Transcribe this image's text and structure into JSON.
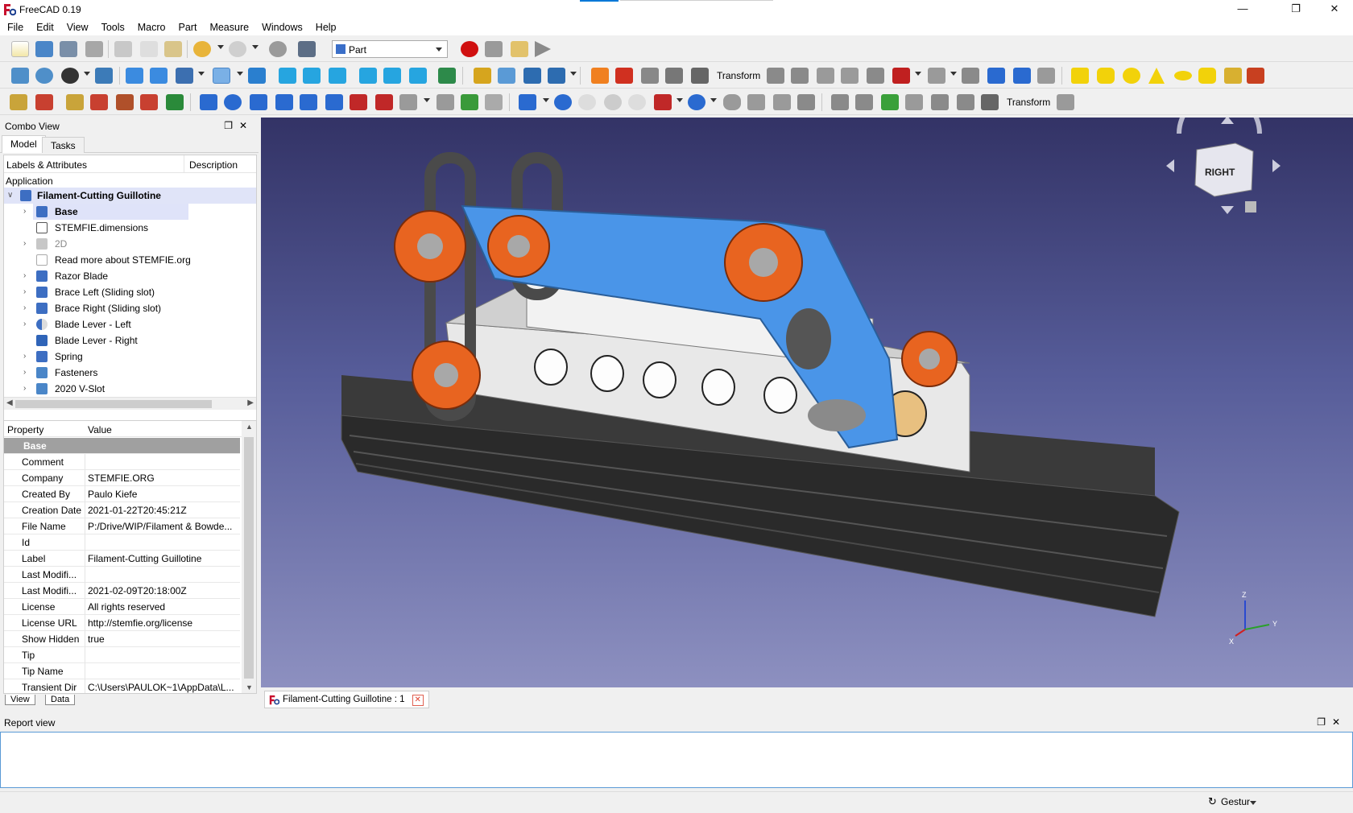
{
  "app": {
    "title": "FreeCAD 0.19",
    "window_controls": [
      "minimize",
      "restore",
      "close"
    ]
  },
  "menu": [
    "File",
    "Edit",
    "View",
    "Tools",
    "Macro",
    "Part",
    "Measure",
    "Windows",
    "Help"
  ],
  "toolbar": {
    "workbench": "Part",
    "transform_label_1": "Transform",
    "transform_label_2": "Transform"
  },
  "combo_view": {
    "title": "Combo View",
    "tabs": [
      "Model",
      "Tasks"
    ],
    "tree_headers": [
      "Labels & Attributes",
      "Description"
    ],
    "section": "Application",
    "document": "Filament-Cutting Guillotine",
    "items": [
      {
        "label": "Base",
        "icon": "part-icon"
      },
      {
        "label": "STEMFIE.dimensions",
        "icon": "spreadsheet-icon"
      },
      {
        "label": "2D",
        "icon": "folder-icon"
      },
      {
        "label": "Read more about STEMFIE.org",
        "icon": "text-document-icon"
      },
      {
        "label": "Razor Blade",
        "icon": "part-icon"
      },
      {
        "label": "Brace Left (Sliding slot)",
        "icon": "part-icon"
      },
      {
        "label": "Brace Right (Sliding slot)",
        "icon": "part-icon"
      },
      {
        "label": "Blade Lever - Left",
        "icon": "part-half-icon"
      },
      {
        "label": "Blade Lever - Right",
        "icon": "solid-icon"
      },
      {
        "label": "Spring",
        "icon": "part-icon"
      },
      {
        "label": "Fasteners",
        "icon": "folder-icon"
      },
      {
        "label": "2020 V-Slot",
        "icon": "folder-icon"
      }
    ]
  },
  "property_editor": {
    "headers": [
      "Property",
      "Value"
    ],
    "group": "Base",
    "rows": [
      {
        "name": "Comment",
        "value": ""
      },
      {
        "name": "Company",
        "value": "STEMFIE.ORG"
      },
      {
        "name": "Created By",
        "value": "Paulo Kiefe"
      },
      {
        "name": "Creation Date",
        "value": "2021-01-22T20:45:21Z"
      },
      {
        "name": "File Name",
        "value": "P:/Drive/WIP/Filament & Bowde..."
      },
      {
        "name": "Id",
        "value": ""
      },
      {
        "name": "Label",
        "value": "Filament-Cutting Guillotine"
      },
      {
        "name": "Last Modifi...",
        "value": ""
      },
      {
        "name": "Last Modifi...",
        "value": "2021-02-09T20:18:00Z"
      },
      {
        "name": "License",
        "value": "All rights reserved"
      },
      {
        "name": "License URL",
        "value": "http://stemfie.org/license"
      },
      {
        "name": "Show Hidden",
        "value": "true"
      },
      {
        "name": "Tip",
        "value": ""
      },
      {
        "name": "Tip Name",
        "value": ""
      },
      {
        "name": "Transient Dir",
        "value": "C:\\Users\\PAULOK~1\\AppData\\L..."
      }
    ],
    "view_tabs": [
      "View",
      "Data"
    ]
  },
  "viewport": {
    "navcube_face": "RIGHT",
    "axes": [
      "Z",
      "Y",
      "X"
    ]
  },
  "document_tab": "Filament-Cutting Guillotine : 1",
  "report_view": {
    "title": "Report view"
  },
  "status": {
    "navigation_style": "Gestur"
  },
  "colors": {
    "viewport_top": "#333366",
    "viewport_bottom": "#8d90c0",
    "selection": "#cce0ff",
    "accent": "#0078d7"
  }
}
